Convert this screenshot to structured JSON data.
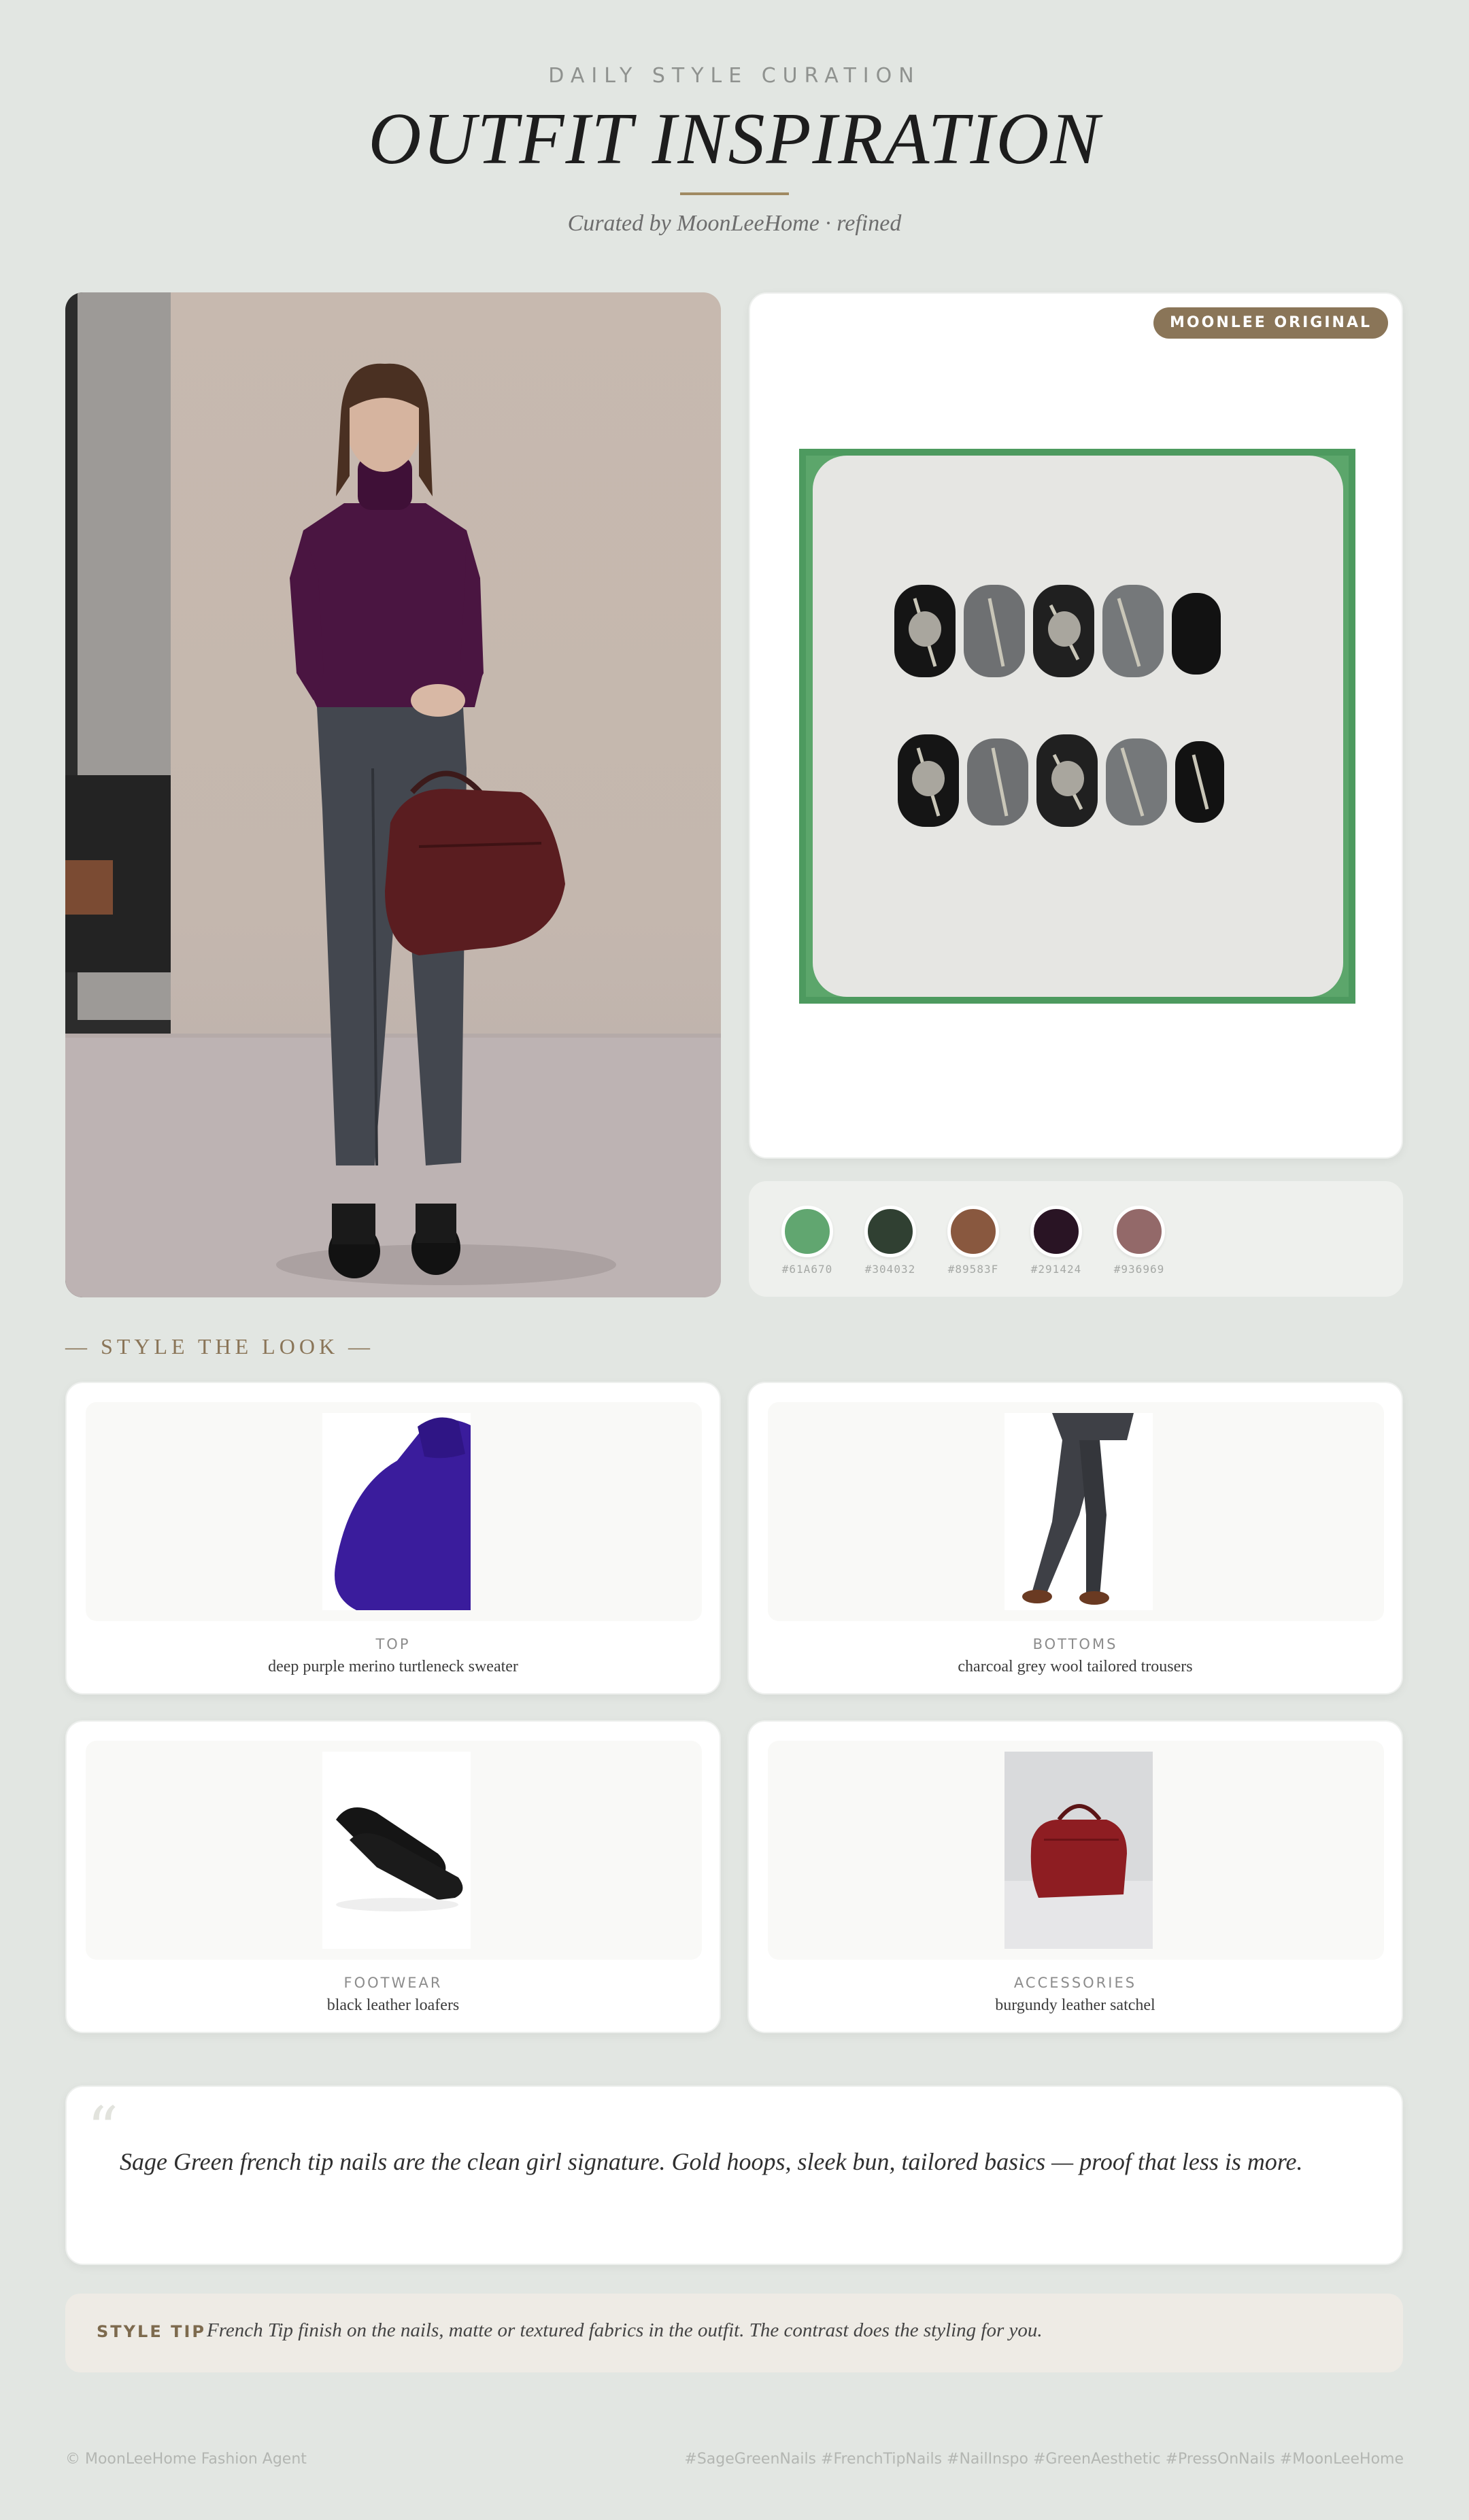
{
  "header": {
    "eyebrow": "DAILY STYLE CURATION",
    "title": "OUTFIT INSPIRATION",
    "subtitle": "Curated by MoonLeeHome · refined"
  },
  "nails": {
    "badge": "MOONLEE ORIGINAL"
  },
  "palette": [
    {
      "hex": "#61A670",
      "label": "#61A670"
    },
    {
      "hex": "#304032",
      "label": "#304032"
    },
    {
      "hex": "#89583F",
      "label": "#89583F"
    },
    {
      "hex": "#291424",
      "label": "#291424"
    },
    {
      "hex": "#936969",
      "label": "#936969"
    }
  ],
  "section_label": "— STYLE THE LOOK —",
  "items": [
    {
      "category": "TOP",
      "description": "deep purple merino turtleneck sweater"
    },
    {
      "category": "BOTTOMS",
      "description": "charcoal grey wool tailored trousers"
    },
    {
      "category": "FOOTWEAR",
      "description": "black leather loafers"
    },
    {
      "category": "ACCESSORIES",
      "description": "burgundy leather satchel"
    }
  ],
  "quote": {
    "mark": "“",
    "text": "Sage Green french tip nails are the clean girl signature. Gold hoops, sleek bun, tailored basics — proof that less is more."
  },
  "tip": {
    "label": "STYLE TIP",
    "text": "French Tip finish on the nails, matte or textured fabrics in the outfit. The contrast does the styling for you."
  },
  "footer": {
    "left": "© MoonLeeHome Fashion Agent",
    "right": "#SageGreenNails #FrenchTipNails #NailInspo #GreenAesthetic #PressOnNails #MoonLeeHome"
  }
}
